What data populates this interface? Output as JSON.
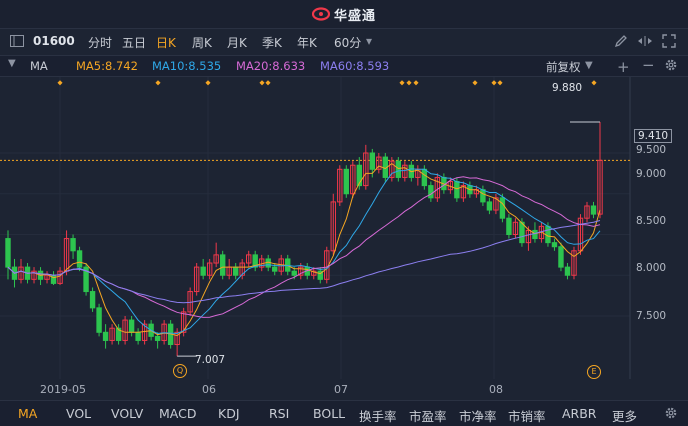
{
  "app": {
    "brand": "华盛通"
  },
  "toolbar": {
    "code": "01600",
    "periods": [
      "分时",
      "五日",
      "日K",
      "周K",
      "月K",
      "季K",
      "年K",
      "60分"
    ],
    "active_period": "日K",
    "period_dropdown_arrow": "▾"
  },
  "ma_bar": {
    "label": "MA",
    "ma5": "MA5:8.742",
    "ma10": "MA10:8.535",
    "ma20": "MA20:8.633",
    "ma60": "MA60:8.593",
    "adjust": "前复权",
    "colors": {
      "ma5": "#f5a623",
      "ma10": "#2fa8e8",
      "ma20": "#d66ad6",
      "ma60": "#8c7ff0"
    }
  },
  "price_axis": {
    "ticks": [
      "9.500",
      "9.000",
      "8.500",
      "8.000",
      "7.500"
    ],
    "current": "9.410"
  },
  "annotations": {
    "high": "9.880",
    "low": "7.007",
    "marker_q": "Q",
    "marker_e": "E"
  },
  "x_axis": {
    "labels": [
      "2019-05",
      "06",
      "07",
      "08"
    ]
  },
  "indicators": {
    "items": [
      "MA",
      "VOL",
      "VOLV",
      "MACD",
      "KDJ",
      "RSI",
      "BOLL",
      "换手率",
      "市盈率",
      "市净率",
      "市销率",
      "ARBR",
      "更多"
    ],
    "active": "MA"
  },
  "colors": {
    "up": "#f0384a",
    "down": "#2dc44f",
    "bg": "#1d2433",
    "accent": "#f5a623"
  },
  "chart_data": {
    "type": "candlestick",
    "x_labels": [
      "2019-05",
      "06",
      "07",
      "08"
    ],
    "ylim": [
      6.9,
      10.0
    ],
    "yticks": [
      7.5,
      8.0,
      8.5,
      9.0,
      9.5
    ],
    "current_price": 9.41,
    "candles": [
      [
        8.45,
        8.1,
        8.55,
        7.95
      ],
      [
        8.1,
        7.95,
        8.2,
        7.85
      ],
      [
        7.95,
        8.1,
        8.2,
        7.9
      ],
      [
        8.1,
        7.95,
        8.15,
        7.9
      ],
      [
        7.95,
        8.05,
        8.1,
        7.9
      ],
      [
        8.05,
        7.95,
        8.1,
        7.88
      ],
      [
        7.95,
        8.0,
        8.05,
        7.9
      ],
      [
        8.0,
        7.9,
        8.05,
        7.88
      ],
      [
        7.9,
        8.05,
        8.1,
        7.88
      ],
      [
        8.05,
        8.45,
        8.55,
        8.0
      ],
      [
        8.45,
        8.3,
        8.5,
        8.2
      ],
      [
        8.3,
        8.1,
        8.35,
        8.05
      ],
      [
        8.1,
        7.8,
        8.15,
        7.75
      ],
      [
        7.8,
        7.6,
        7.85,
        7.55
      ],
      [
        7.6,
        7.3,
        7.65,
        7.25
      ],
      [
        7.3,
        7.2,
        7.4,
        7.1
      ],
      [
        7.2,
        7.35,
        7.4,
        7.15
      ],
      [
        7.35,
        7.2,
        7.4,
        7.15
      ],
      [
        7.2,
        7.45,
        7.5,
        7.15
      ],
      [
        7.45,
        7.3,
        7.5,
        7.25
      ],
      [
        7.3,
        7.2,
        7.35,
        7.15
      ],
      [
        7.2,
        7.4,
        7.45,
        7.15
      ],
      [
        7.4,
        7.25,
        7.45,
        7.2
      ],
      [
        7.25,
        7.2,
        7.3,
        7.1
      ],
      [
        7.2,
        7.4,
        7.45,
        7.15
      ],
      [
        7.4,
        7.15,
        7.45,
        7.1
      ],
      [
        7.15,
        7.3,
        7.35,
        7.007
      ],
      [
        7.3,
        7.55,
        7.6,
        7.25
      ],
      [
        7.55,
        7.8,
        7.85,
        7.5
      ],
      [
        7.8,
        8.1,
        8.15,
        7.75
      ],
      [
        8.1,
        8.0,
        8.2,
        7.95
      ],
      [
        8.0,
        8.15,
        8.2,
        7.95
      ],
      [
        8.15,
        8.25,
        8.4,
        8.1
      ],
      [
        8.25,
        8.0,
        8.3,
        7.95
      ],
      [
        8.0,
        8.1,
        8.2,
        7.95
      ],
      [
        8.1,
        8.0,
        8.15,
        7.95
      ],
      [
        8.0,
        8.15,
        8.2,
        7.95
      ],
      [
        8.15,
        8.25,
        8.3,
        8.1
      ],
      [
        8.25,
        8.1,
        8.3,
        8.05
      ],
      [
        8.1,
        8.2,
        8.25,
        8.05
      ],
      [
        8.2,
        8.1,
        8.25,
        8.05
      ],
      [
        8.1,
        8.05,
        8.15,
        8.0
      ],
      [
        8.05,
        8.2,
        8.25,
        8.0
      ],
      [
        8.2,
        8.05,
        8.25,
        8.0
      ],
      [
        8.05,
        8.0,
        8.1,
        7.95
      ],
      [
        8.0,
        8.1,
        8.15,
        7.95
      ],
      [
        8.1,
        8.0,
        8.15,
        7.95
      ],
      [
        8.0,
        8.05,
        8.1,
        7.95
      ],
      [
        8.05,
        7.95,
        8.1,
        7.9
      ],
      [
        7.95,
        8.3,
        8.35,
        7.9
      ],
      [
        8.3,
        8.9,
        9.0,
        8.25
      ],
      [
        8.9,
        9.3,
        9.35,
        8.85
      ],
      [
        9.3,
        9.0,
        9.35,
        8.95
      ],
      [
        9.0,
        9.35,
        9.4,
        8.95
      ],
      [
        9.35,
        9.1,
        9.45,
        9.05
      ],
      [
        9.1,
        9.5,
        9.6,
        9.05
      ],
      [
        9.5,
        9.3,
        9.55,
        9.2
      ],
      [
        9.3,
        9.45,
        9.5,
        9.25
      ],
      [
        9.45,
        9.2,
        9.5,
        9.15
      ],
      [
        9.2,
        9.4,
        9.45,
        9.15
      ],
      [
        9.4,
        9.2,
        9.45,
        9.15
      ],
      [
        9.2,
        9.35,
        9.4,
        9.15
      ],
      [
        9.35,
        9.2,
        9.4,
        9.15
      ],
      [
        9.2,
        9.3,
        9.35,
        9.1
      ],
      [
        9.3,
        9.1,
        9.35,
        9.05
      ],
      [
        9.1,
        8.95,
        9.15,
        8.9
      ],
      [
        8.95,
        9.2,
        9.25,
        8.9
      ],
      [
        9.2,
        9.05,
        9.25,
        9.0
      ],
      [
        9.05,
        9.15,
        9.2,
        9.0
      ],
      [
        9.15,
        8.95,
        9.2,
        8.9
      ],
      [
        8.95,
        9.1,
        9.15,
        8.9
      ],
      [
        9.1,
        9.0,
        9.15,
        8.95
      ],
      [
        9.0,
        9.05,
        9.1,
        8.95
      ],
      [
        9.05,
        8.9,
        9.1,
        8.85
      ],
      [
        8.9,
        8.8,
        8.95,
        8.75
      ],
      [
        8.8,
        8.95,
        9.0,
        8.75
      ],
      [
        8.95,
        8.7,
        9.0,
        8.65
      ],
      [
        8.7,
        8.5,
        8.75,
        8.45
      ],
      [
        8.5,
        8.65,
        8.7,
        8.45
      ],
      [
        8.65,
        8.4,
        8.7,
        8.35
      ],
      [
        8.4,
        8.55,
        8.6,
        8.3
      ],
      [
        8.55,
        8.45,
        8.65,
        8.4
      ],
      [
        8.45,
        8.6,
        8.65,
        8.4
      ],
      [
        8.6,
        8.4,
        8.65,
        8.35
      ],
      [
        8.4,
        8.35,
        8.45,
        8.3
      ],
      [
        8.35,
        8.1,
        8.4,
        8.05
      ],
      [
        8.1,
        8.0,
        8.15,
        7.95
      ],
      [
        8.0,
        8.3,
        8.35,
        7.95
      ],
      [
        8.3,
        8.7,
        8.75,
        8.25
      ],
      [
        8.7,
        8.85,
        8.9,
        8.65
      ],
      [
        8.85,
        8.75,
        8.9,
        8.7
      ],
      [
        8.75,
        9.41,
        9.88,
        8.7
      ]
    ]
  }
}
